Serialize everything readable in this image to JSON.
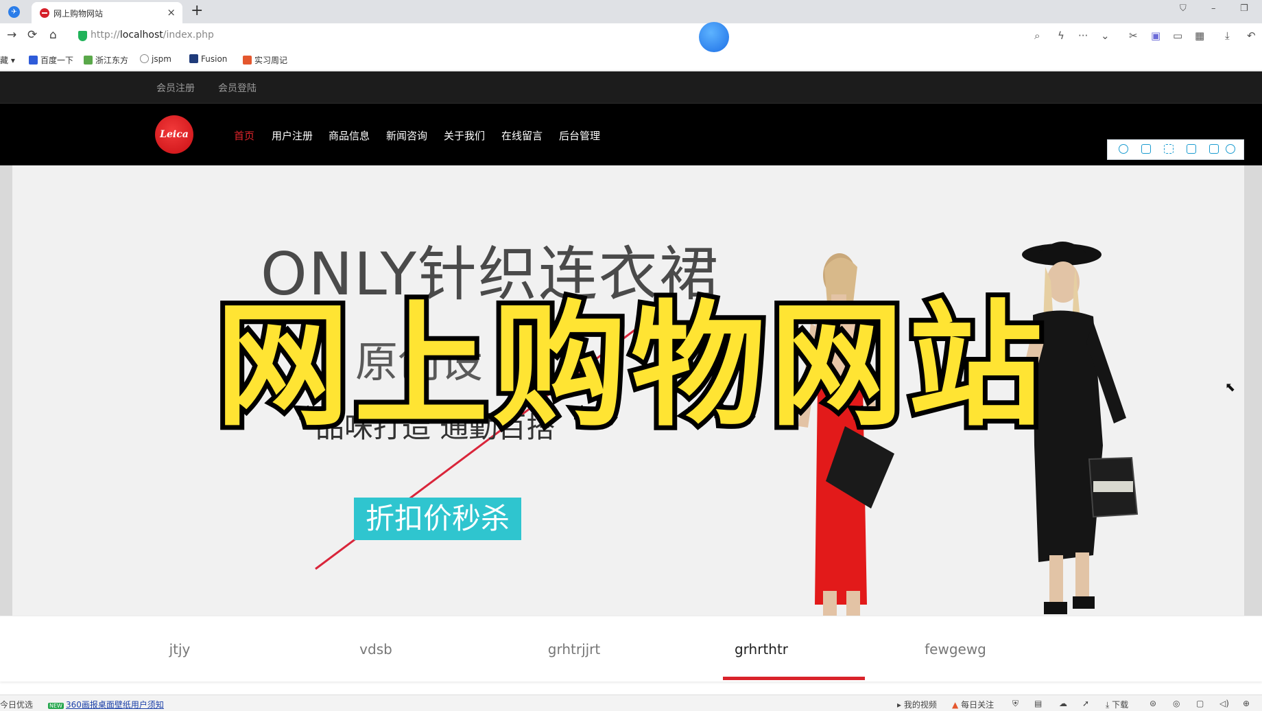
{
  "browser": {
    "tab_title": "网上购物网站",
    "tab_close": "×",
    "new_tab": "+",
    "url_prefix": "http://",
    "url_host": "localhost",
    "url_path": "/index.php",
    "nav_icons": [
      "back-arrow-icon",
      "reload-icon",
      "home-icon"
    ],
    "bookmarks": [
      {
        "label": "藏",
        "color": "#888888"
      },
      {
        "label": "百度一下",
        "color": "#2e5bd9"
      },
      {
        "label": "浙江东方",
        "color": "#5aa84a"
      },
      {
        "label": "jspm",
        "color": "#888888"
      },
      {
        "label": "Fusion",
        "color": "#1f3b7a"
      },
      {
        "label": "实习周记",
        "color": "#e4572e"
      }
    ]
  },
  "site": {
    "top_links": [
      "会员注册",
      "会员登陆"
    ],
    "logo_text": "Leica",
    "nav": [
      {
        "label": "首页",
        "active": true
      },
      {
        "label": "用户注册",
        "active": false
      },
      {
        "label": "商品信息",
        "active": false
      },
      {
        "label": "新闻咨询",
        "active": false
      },
      {
        "label": "关于我们",
        "active": false
      },
      {
        "label": "在线留言",
        "active": false
      },
      {
        "label": "后台管理",
        "active": false
      }
    ],
    "banner": {
      "title": "ONLY针织连衣裙",
      "subtitle": "原创设",
      "slogan": "品味打造  通勤百搭",
      "promo": "折扣价秒杀"
    },
    "overlay_title": "网上购物网站",
    "carousel_tabs": [
      {
        "label": "jtjy",
        "active": false
      },
      {
        "label": "vdsb",
        "active": false
      },
      {
        "label": "grhtrjjrt",
        "active": false
      },
      {
        "label": "grhrthtr",
        "active": true
      },
      {
        "label": "fewgewg",
        "active": false
      }
    ]
  },
  "statusbar": {
    "left_text": "今日优选",
    "new_badge": "NEW",
    "notice": "360画报桌面壁纸用户须知",
    "right_items": [
      "我的视频",
      "每日关注",
      "下载"
    ]
  },
  "colors": {
    "accent_red": "#e0242b",
    "promo_cyan": "#2fc5cf",
    "overlay_yellow": "#ffe433"
  }
}
